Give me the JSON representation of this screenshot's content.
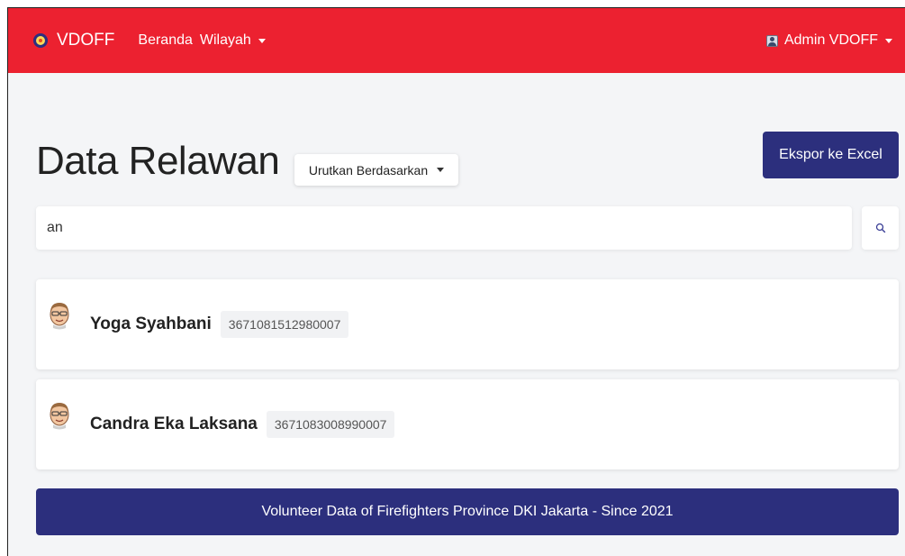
{
  "navbar": {
    "brand": "VDOFF",
    "links": [
      "Beranda",
      "Wilayah"
    ],
    "user": "Admin VDOFF",
    "background_color": "#ec2130"
  },
  "header": {
    "title": "Data Relawan",
    "sort_label": "Urutkan Berdasarkan",
    "export_label": "Ekspor ke Excel"
  },
  "search": {
    "value": "an"
  },
  "volunteers": [
    {
      "name": "Yoga Syahbani",
      "id": "3671081512980007"
    },
    {
      "name": "Candra Eka Laksana",
      "id": "3671083008990007"
    }
  ],
  "footer": {
    "text": "Volunteer Data of Firefighters Province DKI Jakarta - Since 2021",
    "background_color": "#2c2f7d"
  }
}
